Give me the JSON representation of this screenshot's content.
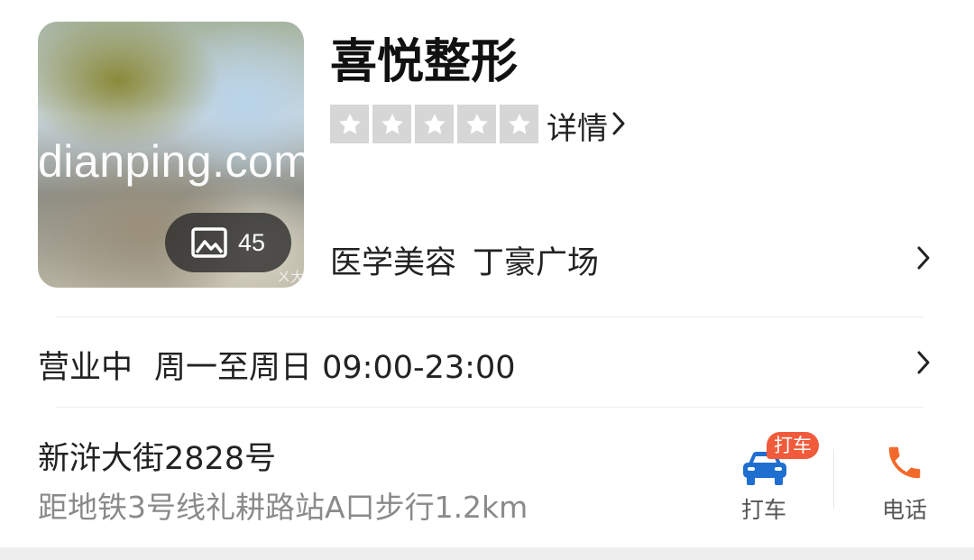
{
  "shop": {
    "name": "喜悦整形",
    "rating_stars": 5,
    "rating_detail_label": "详情",
    "category": "医学美容",
    "area": "丁豪广场"
  },
  "photo": {
    "watermark": "dianping.com",
    "count": "45",
    "corner_mark": "ㄨ大"
  },
  "hours": {
    "status": "营业中",
    "schedule": "周一至周日 09:00-23:00"
  },
  "location": {
    "address": "新浒大街2828号",
    "subway_distance": "距地铁3号线礼耕路站A口步行1.2km"
  },
  "actions": {
    "taxi_tag": "打车",
    "taxi_label": "打车",
    "phone_label": "电话"
  },
  "icons": {
    "photo": "image-icon",
    "star": "star-icon",
    "chevron": "chevron-right-icon",
    "taxi": "car-icon",
    "phone": "phone-icon"
  },
  "colors": {
    "star_empty": "#d6d6d6",
    "taxi_blue": "#1f6fd1",
    "phone_orange": "#f26a2b",
    "taxi_tag_red": "#f15a3a",
    "secondary_text": "#8a8a8a"
  }
}
